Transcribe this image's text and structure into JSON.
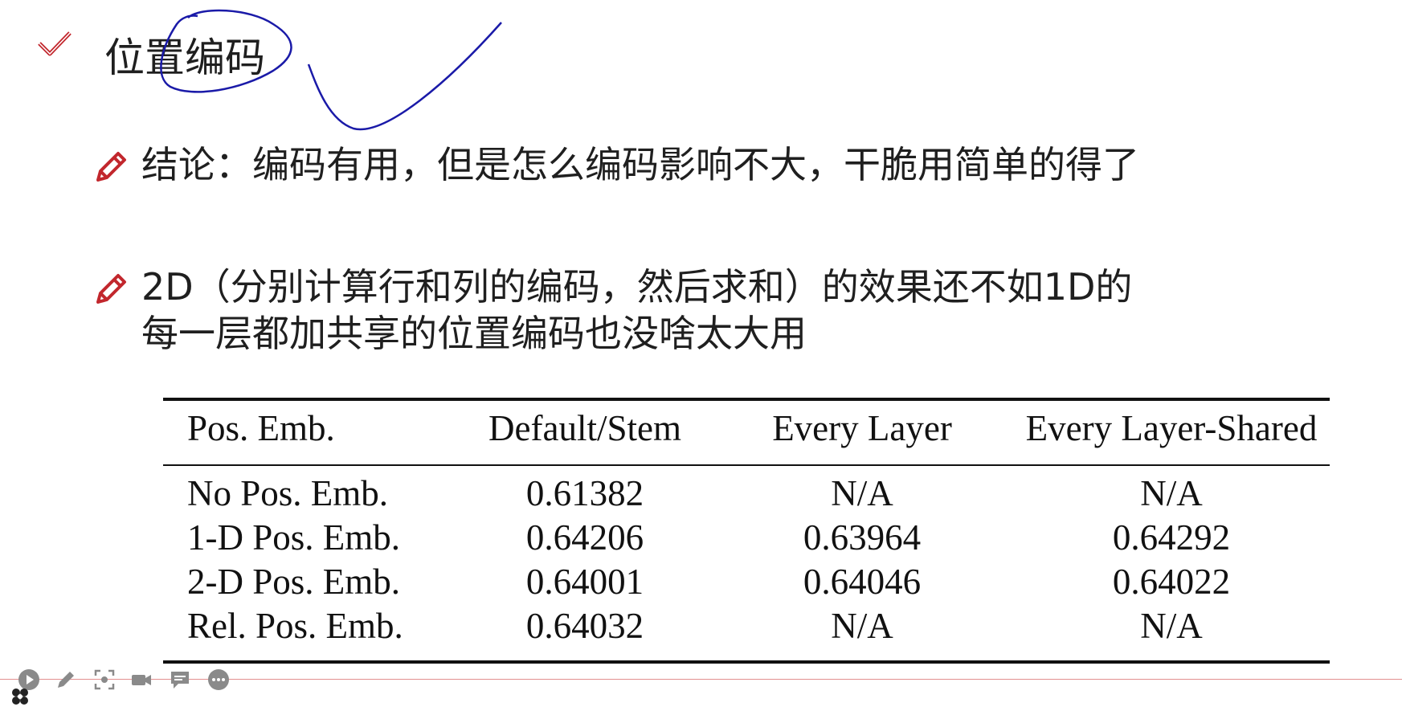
{
  "slide": {
    "heading": "位置编码",
    "bullet1": "结论：编码有用，但是怎么编码影响不大，干脆用简单的得了",
    "bullet2_line1": "2D（分别计算行和列的编码，然后求和）的效果还不如1D的",
    "bullet2_line2": "每一层都加共享的位置编码也没啥太大用"
  },
  "table": {
    "headers": [
      "Pos. Emb.",
      "Default/Stem",
      "Every Layer",
      "Every Layer-Shared"
    ],
    "rows": [
      [
        "No Pos. Emb.",
        "0.61382",
        "N/A",
        "N/A"
      ],
      [
        "1-D Pos. Emb.",
        "0.64206",
        "0.63964",
        "0.64292"
      ],
      [
        "2-D Pos. Emb.",
        "0.64001",
        "0.64046",
        "0.64022"
      ],
      [
        "Rel. Pos. Emb.",
        "0.64032",
        "N/A",
        "N/A"
      ]
    ]
  },
  "colors": {
    "check": "#c2272d",
    "pencil": "#c2272d",
    "annotation": "#1a1aa8",
    "toolbar_icon": "#8a8a8a",
    "toolbar_line": "#e38f8f"
  },
  "icons": [
    "check-icon",
    "pencil-icon",
    "play-icon",
    "pen-icon",
    "screenshot-icon",
    "camera-icon",
    "chat-icon",
    "more-icon",
    "logo-icon"
  ]
}
